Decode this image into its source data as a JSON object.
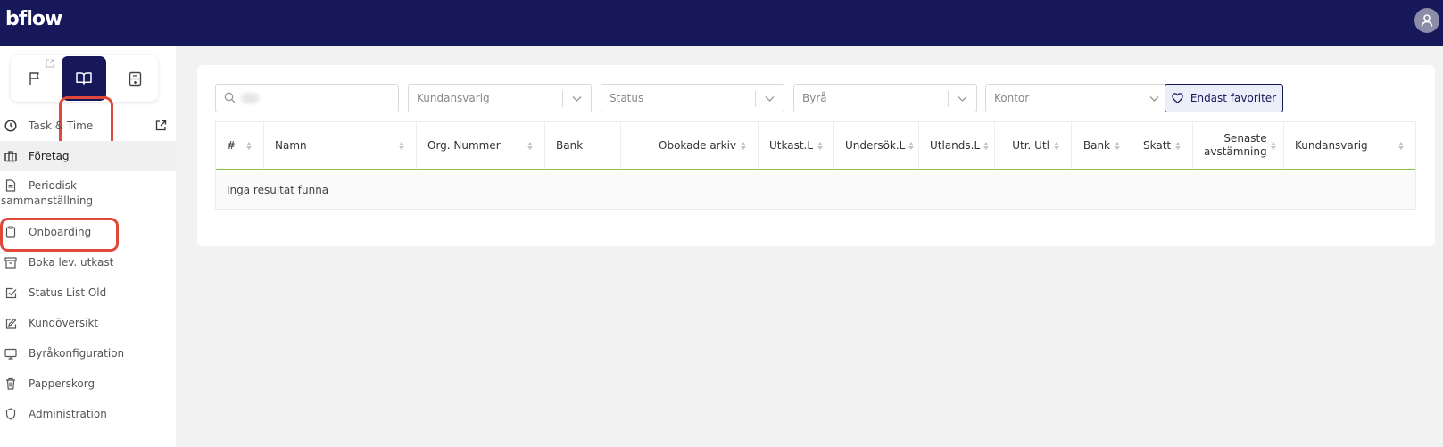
{
  "app": {
    "logo": "bflow"
  },
  "sidebar": {
    "items": [
      {
        "label": "Task & Time",
        "icon": "clock-icon"
      },
      {
        "label": "Företag",
        "icon": "briefcase-icon"
      },
      {
        "label": "Periodisk sammanställning",
        "icon": "document-icon"
      },
      {
        "label": "Onboarding",
        "icon": "clipboard-icon"
      },
      {
        "label": "Boka lev. utkast",
        "icon": "archive-icon"
      },
      {
        "label": "Status List Old",
        "icon": "checkbox-icon"
      },
      {
        "label": "Kundöversikt",
        "icon": "edit-icon"
      },
      {
        "label": "Byråkonfiguration",
        "icon": "monitor-icon"
      },
      {
        "label": "Papperskorg",
        "icon": "trash-icon"
      },
      {
        "label": "Administration",
        "icon": "shield-icon"
      }
    ],
    "periodisk_line1": "Periodisk",
    "periodisk_line2": "sammanställning"
  },
  "filters": {
    "search_placeholder": "",
    "kundansvarig": "Kundansvarig",
    "status": "Status",
    "byra": "Byrå",
    "kontor": "Kontor",
    "favorites_label": "Endast favoriter"
  },
  "table": {
    "columns": [
      "#",
      "Namn",
      "Org. Nummer",
      "Bank",
      "Obokade arkiv",
      "Utkast.L",
      "Undersök.L",
      "Utlands.L",
      "Utr. Utl",
      "Bank",
      "Skatt",
      "Senaste avstämning",
      "Kundansvarig"
    ],
    "senaste_line1": "Senaste",
    "senaste_line2": "avstämning",
    "empty_message": "Inga resultat funna"
  },
  "colors": {
    "topbar": "#16185a",
    "highlight": "#e0483a",
    "table_accent": "#8bc34a"
  }
}
